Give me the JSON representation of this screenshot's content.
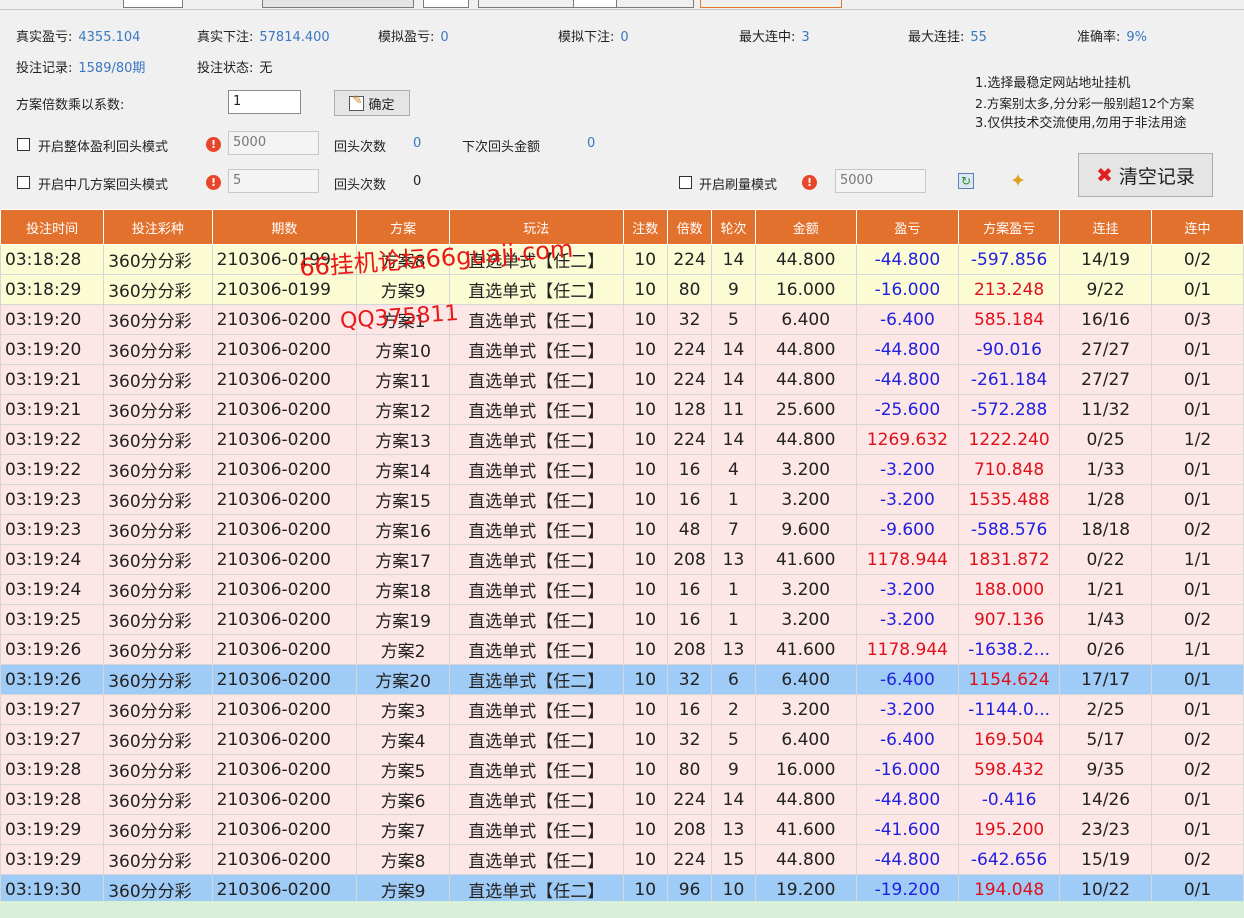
{
  "stats": {
    "real_profit_label": "真实盈亏:",
    "real_profit": "4355.104",
    "real_bet_label": "真实下注:",
    "real_bet": "57814.400",
    "sim_profit_label": "模拟盈亏:",
    "sim_profit": "0",
    "sim_bet_label": "模拟下注:",
    "sim_bet": "0",
    "max_win_streak_label": "最大连中:",
    "max_win_streak": "3",
    "max_loss_streak_label": "最大连挂:",
    "max_loss_streak": "55",
    "accuracy_label": "准确率:",
    "accuracy": "9%",
    "bet_record_label": "投注记录:",
    "bet_record": "1589/80期",
    "bet_status_label": "投注状态:",
    "bet_status": "无"
  },
  "multiplier": {
    "label": "方案倍数乘以系数:",
    "value": "1",
    "confirm": "确定"
  },
  "rollback_overall": {
    "label": "开启整体盈利回头模式",
    "amount": "5000",
    "count_label": "回头次数",
    "count": "0",
    "next_label": "下次回头金额",
    "next": "0"
  },
  "rollback_hits": {
    "label": "开启中几方案回头模式",
    "amount": "5",
    "count_label": "回头次数",
    "count": "0"
  },
  "volume_mode": {
    "label": "开启刷量模式",
    "amount": "5000"
  },
  "notes": [
    "1.选择最稳定网站地址挂机",
    "2.方案别太多,分分彩一般别超12个方案",
    "3.仅供技术交流使用,勿用于非法用途"
  ],
  "clear_button": "清空记录",
  "watermark": {
    "line1": "66挂机论坛66guaji.com",
    "line2": "QQ375811"
  },
  "table": {
    "headers": [
      "投注时间",
      "投注彩种",
      "期数",
      "方案",
      "玩法",
      "注数",
      "倍数",
      "轮次",
      "金额",
      "盈亏",
      "方案盈亏",
      "连挂",
      "连中"
    ],
    "rows": [
      {
        "style": "yellow",
        "c": [
          "03:18:28",
          "360分分彩",
          "210306-0199",
          "方案8",
          "直选单式【任二】",
          "10",
          "224",
          "14",
          "44.800",
          "-44.800",
          "-597.856",
          "14/19",
          "0/2"
        ]
      },
      {
        "style": "yellow",
        "c": [
          "03:18:29",
          "360分分彩",
          "210306-0199",
          "方案9",
          "直选单式【任二】",
          "10",
          "80",
          "9",
          "16.000",
          "-16.000",
          "213.248",
          "9/22",
          "0/1"
        ]
      },
      {
        "style": "pink",
        "c": [
          "03:19:20",
          "360分分彩",
          "210306-0200",
          "方案1",
          "直选单式【任二】",
          "10",
          "32",
          "5",
          "6.400",
          "-6.400",
          "585.184",
          "16/16",
          "0/3"
        ]
      },
      {
        "style": "pink",
        "c": [
          "03:19:20",
          "360分分彩",
          "210306-0200",
          "方案10",
          "直选单式【任二】",
          "10",
          "224",
          "14",
          "44.800",
          "-44.800",
          "-90.016",
          "27/27",
          "0/1"
        ]
      },
      {
        "style": "pink",
        "c": [
          "03:19:21",
          "360分分彩",
          "210306-0200",
          "方案11",
          "直选单式【任二】",
          "10",
          "224",
          "14",
          "44.800",
          "-44.800",
          "-261.184",
          "27/27",
          "0/1"
        ]
      },
      {
        "style": "pink",
        "c": [
          "03:19:21",
          "360分分彩",
          "210306-0200",
          "方案12",
          "直选单式【任二】",
          "10",
          "128",
          "11",
          "25.600",
          "-25.600",
          "-572.288",
          "11/32",
          "0/1"
        ]
      },
      {
        "style": "pink",
        "c": [
          "03:19:22",
          "360分分彩",
          "210306-0200",
          "方案13",
          "直选单式【任二】",
          "10",
          "224",
          "14",
          "44.800",
          "1269.632",
          "1222.240",
          "0/25",
          "1/2"
        ]
      },
      {
        "style": "pink",
        "c": [
          "03:19:22",
          "360分分彩",
          "210306-0200",
          "方案14",
          "直选单式【任二】",
          "10",
          "16",
          "4",
          "3.200",
          "-3.200",
          "710.848",
          "1/33",
          "0/1"
        ]
      },
      {
        "style": "pink",
        "c": [
          "03:19:23",
          "360分分彩",
          "210306-0200",
          "方案15",
          "直选单式【任二】",
          "10",
          "16",
          "1",
          "3.200",
          "-3.200",
          "1535.488",
          "1/28",
          "0/1"
        ]
      },
      {
        "style": "pink",
        "c": [
          "03:19:23",
          "360分分彩",
          "210306-0200",
          "方案16",
          "直选单式【任二】",
          "10",
          "48",
          "7",
          "9.600",
          "-9.600",
          "-588.576",
          "18/18",
          "0/2"
        ]
      },
      {
        "style": "pink",
        "c": [
          "03:19:24",
          "360分分彩",
          "210306-0200",
          "方案17",
          "直选单式【任二】",
          "10",
          "208",
          "13",
          "41.600",
          "1178.944",
          "1831.872",
          "0/22",
          "1/1"
        ]
      },
      {
        "style": "pink",
        "c": [
          "03:19:24",
          "360分分彩",
          "210306-0200",
          "方案18",
          "直选单式【任二】",
          "10",
          "16",
          "1",
          "3.200",
          "-3.200",
          "188.000",
          "1/21",
          "0/1"
        ]
      },
      {
        "style": "pink",
        "c": [
          "03:19:25",
          "360分分彩",
          "210306-0200",
          "方案19",
          "直选单式【任二】",
          "10",
          "16",
          "1",
          "3.200",
          "-3.200",
          "907.136",
          "1/43",
          "0/2"
        ]
      },
      {
        "style": "pink",
        "c": [
          "03:19:26",
          "360分分彩",
          "210306-0200",
          "方案2",
          "直选单式【任二】",
          "10",
          "208",
          "13",
          "41.600",
          "1178.944",
          "-1638.2...",
          "0/26",
          "1/1"
        ]
      },
      {
        "style": "blue",
        "c": [
          "03:19:26",
          "360分分彩",
          "210306-0200",
          "方案20",
          "直选单式【任二】",
          "10",
          "32",
          "6",
          "6.400",
          "-6.400",
          "1154.624",
          "17/17",
          "0/1"
        ]
      },
      {
        "style": "pink",
        "c": [
          "03:19:27",
          "360分分彩",
          "210306-0200",
          "方案3",
          "直选单式【任二】",
          "10",
          "16",
          "2",
          "3.200",
          "-3.200",
          "-1144.0...",
          "2/25",
          "0/1"
        ]
      },
      {
        "style": "pink",
        "c": [
          "03:19:27",
          "360分分彩",
          "210306-0200",
          "方案4",
          "直选单式【任二】",
          "10",
          "32",
          "5",
          "6.400",
          "-6.400",
          "169.504",
          "5/17",
          "0/2"
        ]
      },
      {
        "style": "pink",
        "c": [
          "03:19:28",
          "360分分彩",
          "210306-0200",
          "方案5",
          "直选单式【任二】",
          "10",
          "80",
          "9",
          "16.000",
          "-16.000",
          "598.432",
          "9/35",
          "0/2"
        ]
      },
      {
        "style": "pink",
        "c": [
          "03:19:28",
          "360分分彩",
          "210306-0200",
          "方案6",
          "直选单式【任二】",
          "10",
          "224",
          "14",
          "44.800",
          "-44.800",
          "-0.416",
          "14/26",
          "0/1"
        ]
      },
      {
        "style": "pink",
        "c": [
          "03:19:29",
          "360分分彩",
          "210306-0200",
          "方案7",
          "直选单式【任二】",
          "10",
          "208",
          "13",
          "41.600",
          "-41.600",
          "195.200",
          "23/23",
          "0/1"
        ]
      },
      {
        "style": "pink",
        "c": [
          "03:19:29",
          "360分分彩",
          "210306-0200",
          "方案8",
          "直选单式【任二】",
          "10",
          "224",
          "15",
          "44.800",
          "-44.800",
          "-642.656",
          "15/19",
          "0/2"
        ]
      },
      {
        "style": "blue",
        "c": [
          "03:19:30",
          "360分分彩",
          "210306-0200",
          "方案9",
          "直选单式【任二】",
          "10",
          "96",
          "10",
          "19.200",
          "-19.200",
          "194.048",
          "10/22",
          "0/1"
        ]
      }
    ]
  }
}
